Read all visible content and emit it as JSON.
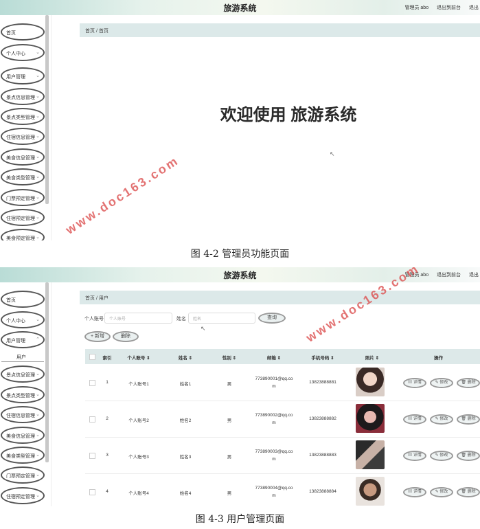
{
  "app_title": "旅游系统",
  "top_right": {
    "admin": "管理员 abo",
    "back_front": "退出到前台",
    "logout": "退出"
  },
  "screen1": {
    "menu": [
      "首页",
      "个人中心",
      "用户管理",
      "景点信息管理",
      "景点类型管理",
      "住宿信息管理",
      "美食信息管理",
      "美食类型管理",
      "门票预定管理",
      "住宿预定管理",
      "美食预定管理"
    ],
    "breadcrumb": "首页 / 首页",
    "welcome": "欢迎使用 旅游系统",
    "watermark": "www.doc163.com"
  },
  "caption1": "图 4-2  管理员功能页面",
  "screen2": {
    "menu_top": [
      "首页",
      "个人中心",
      "用户管理"
    ],
    "submenu": "用户",
    "menu_bottom": [
      "景点信息管理",
      "景点类型管理",
      "住宿信息管理",
      "美食信息管理",
      "美食类型管理",
      "门票预定管理",
      "住宿预定管理"
    ],
    "breadcrumb": "首页 / 用户",
    "search": {
      "account_label": "个人账号",
      "account_placeholder": "个人账号",
      "name_label": "姓名",
      "name_placeholder": "姓名",
      "query_button": "查询"
    },
    "add_button": "+ 新增",
    "delete_button": "删除",
    "columns": [
      "索引",
      "个人账号 ⇕",
      "姓名 ⇕",
      "性别 ⇕",
      "邮箱 ⇕",
      "手机号码 ⇕",
      "照片 ⇕",
      "操作"
    ],
    "rows": [
      {
        "index": "1",
        "account": "个人账号1",
        "name": "姓名1",
        "gender": "男",
        "email_a": "773890001@qq.co",
        "email_b": "m",
        "phone": "13823888881"
      },
      {
        "index": "2",
        "account": "个人账号2",
        "name": "姓名2",
        "gender": "男",
        "email_a": "773890002@qq.co",
        "email_b": "m",
        "phone": "13823888882"
      },
      {
        "index": "3",
        "account": "个人账号3",
        "name": "姓名3",
        "gender": "男",
        "email_a": "773890003@qq.co",
        "email_b": "m",
        "phone": "13823888883"
      },
      {
        "index": "4",
        "account": "个人账号4",
        "name": "姓名4",
        "gender": "男",
        "email_a": "773890004@qq.co",
        "email_b": "m",
        "phone": "13823888884"
      }
    ],
    "ops": {
      "detail": "详情",
      "edit": "修改",
      "delete": "删除"
    },
    "watermark": "www.doc163.com"
  },
  "caption2": "图 4-3  用户管理页面",
  "colors": {
    "accent": "#dce9e9",
    "watermark": "#dc5050",
    "border": "#555555"
  }
}
